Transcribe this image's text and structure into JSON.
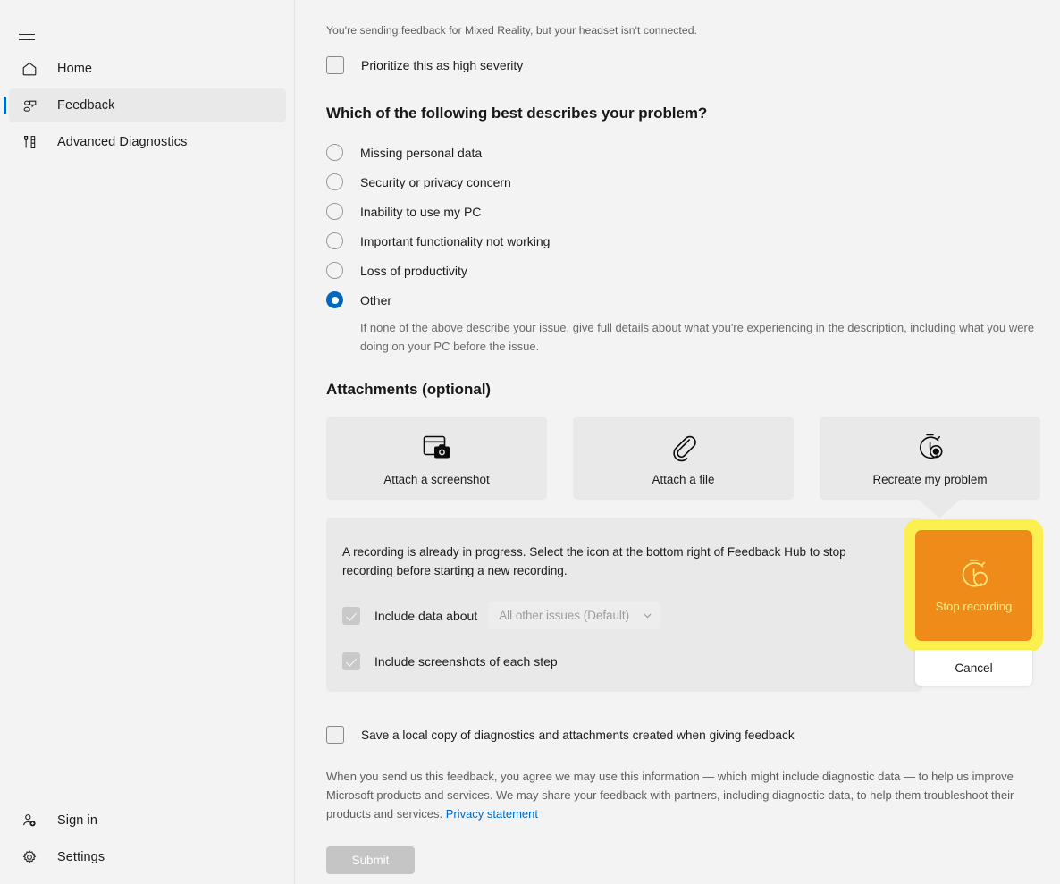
{
  "sidebar": {
    "menu_button": "hamburger-menu",
    "items": [
      {
        "label": "Home",
        "icon": "home-icon",
        "selected": false
      },
      {
        "label": "Feedback",
        "icon": "feedback-icon",
        "selected": true
      },
      {
        "label": "Advanced Diagnostics",
        "icon": "diagnostics-icon",
        "selected": false
      }
    ],
    "bottom_items": [
      {
        "label": "Sign in",
        "icon": "person-add-icon"
      },
      {
        "label": "Settings",
        "icon": "gear-icon"
      }
    ]
  },
  "main": {
    "notice": "You're sending feedback for Mixed Reality, but your headset isn't connected.",
    "prioritize_label": "Prioritize this as high severity",
    "prioritize_checked": false,
    "problem_heading": "Which of the following best describes your problem?",
    "problem_options": [
      {
        "label": "Missing personal data",
        "selected": false
      },
      {
        "label": "Security or privacy concern",
        "selected": false
      },
      {
        "label": "Inability to use my PC",
        "selected": false
      },
      {
        "label": "Important functionality not working",
        "selected": false
      },
      {
        "label": "Loss of productivity",
        "selected": false
      },
      {
        "label": "Other",
        "selected": true
      }
    ],
    "other_hint": "If none of the above describe your issue, give full details about what you're experiencing in the description, including what you were doing on your PC before the issue.",
    "attachments_heading": "Attachments (optional)",
    "attachment_tiles": [
      {
        "label": "Attach a screenshot",
        "icon": "screenshot-icon"
      },
      {
        "label": "Attach a file",
        "icon": "paperclip-icon"
      },
      {
        "label": "Recreate my problem",
        "icon": "stopwatch-record-icon"
      }
    ],
    "recording_panel": {
      "message": "A recording is already in progress. Select the icon at the bottom right of Feedback Hub to stop recording before starting a new recording.",
      "include_data_label": "Include data about",
      "include_data_checked": true,
      "include_data_disabled": true,
      "data_dropdown_value": "All other issues (Default)",
      "include_screenshots_label": "Include screenshots of each step",
      "include_screenshots_checked": true,
      "include_screenshots_disabled": true
    },
    "stop_recording": {
      "label_line1": "Stop",
      "label_line2": "recording",
      "icon": "stopwatch-record-icon",
      "button_color": "#ef8b19",
      "highlight_color": "#fbf04f",
      "text_color": "#ffe680"
    },
    "cancel_label": "Cancel",
    "save_copy_label": "Save a local copy of diagnostics and attachments created when giving feedback",
    "save_copy_checked": false,
    "legal_text": "When you send us this feedback, you agree we may use this information — which might include diagnostic data — to help us improve Microsoft products and services. We may share your feedback with partners, including diagnostic data, to help them troubleshoot their products and services. ",
    "privacy_link": "Privacy statement",
    "submit_label": "Submit"
  },
  "colors": {
    "page_bg": "#f3f3f3",
    "panel_bg": "#e9e9e9",
    "accent": "#0067c0",
    "link": "#0067c0",
    "highlight": "#fbf04f",
    "orange": "#ef8b19"
  }
}
